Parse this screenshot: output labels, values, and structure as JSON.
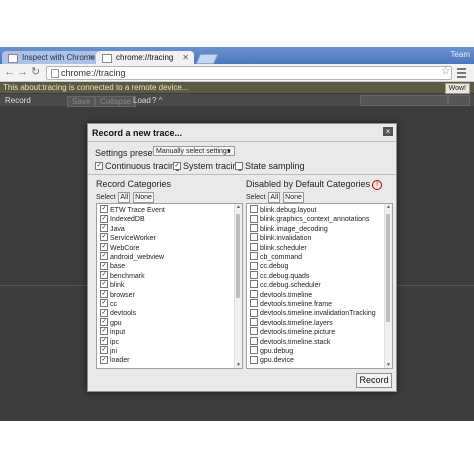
{
  "browser": {
    "tabs": [
      {
        "label": "Inspect with Chrome",
        "active": false
      },
      {
        "label": "chrome://tracing",
        "active": true
      }
    ],
    "user_label": "Team",
    "url": "chrome://tracing"
  },
  "infobar": {
    "text": "This about:tracing is connected to a remote device...",
    "button": "Wow!"
  },
  "page_toolbar": {
    "record": "Record",
    "save": "Save",
    "collapse": "Collapse",
    "load": "Load",
    "view_toggle": "? ^"
  },
  "dialog": {
    "title": "Record a new trace...",
    "close": "×",
    "preset_label": "Settings preset:",
    "preset_value": "Manually select settings",
    "options": [
      {
        "label": "Continuous tracing",
        "checked": true
      },
      {
        "label": "System tracing",
        "checked": true
      },
      {
        "label": "State sampling",
        "checked": false
      }
    ],
    "left": {
      "title": "Record Categories",
      "select_label": "Select",
      "all": "All",
      "none": "None",
      "items": [
        "ETW Trace Event",
        "IndexedDB",
        "Java",
        "ServiceWorker",
        "WebCore",
        "android_webview",
        "base",
        "benchmark",
        "blink",
        "browser",
        "cc",
        "devtools",
        "gpu",
        "input",
        "ipc",
        "jni",
        "loader"
      ]
    },
    "right": {
      "title": "Disabled by Default Categories",
      "warning": "!",
      "select_label": "Select",
      "all": "All",
      "none": "None",
      "items": [
        "blink.debug.layout",
        "blink.graphics_context_annotations",
        "blink.image_decoding",
        "blink.invalidation",
        "blink.scheduler",
        "cb_command",
        "cc.debug",
        "cc.debug.quads",
        "cc.debug.scheduler",
        "devtools.timeline",
        "devtools.timeline.frame",
        "devtools.timeline.invalidationTracking",
        "devtools.timeline.layers",
        "devtools.timeline.picture",
        "devtools.timeline.stack",
        "gpu.debug",
        "gpu.device"
      ]
    },
    "record_button": "Record"
  },
  "colors": {
    "titlebar": "#4c77bd",
    "infobar": "#5d5a44",
    "dialog_bg": "#e9e9e9",
    "page_bg": "#3c3c3c"
  }
}
